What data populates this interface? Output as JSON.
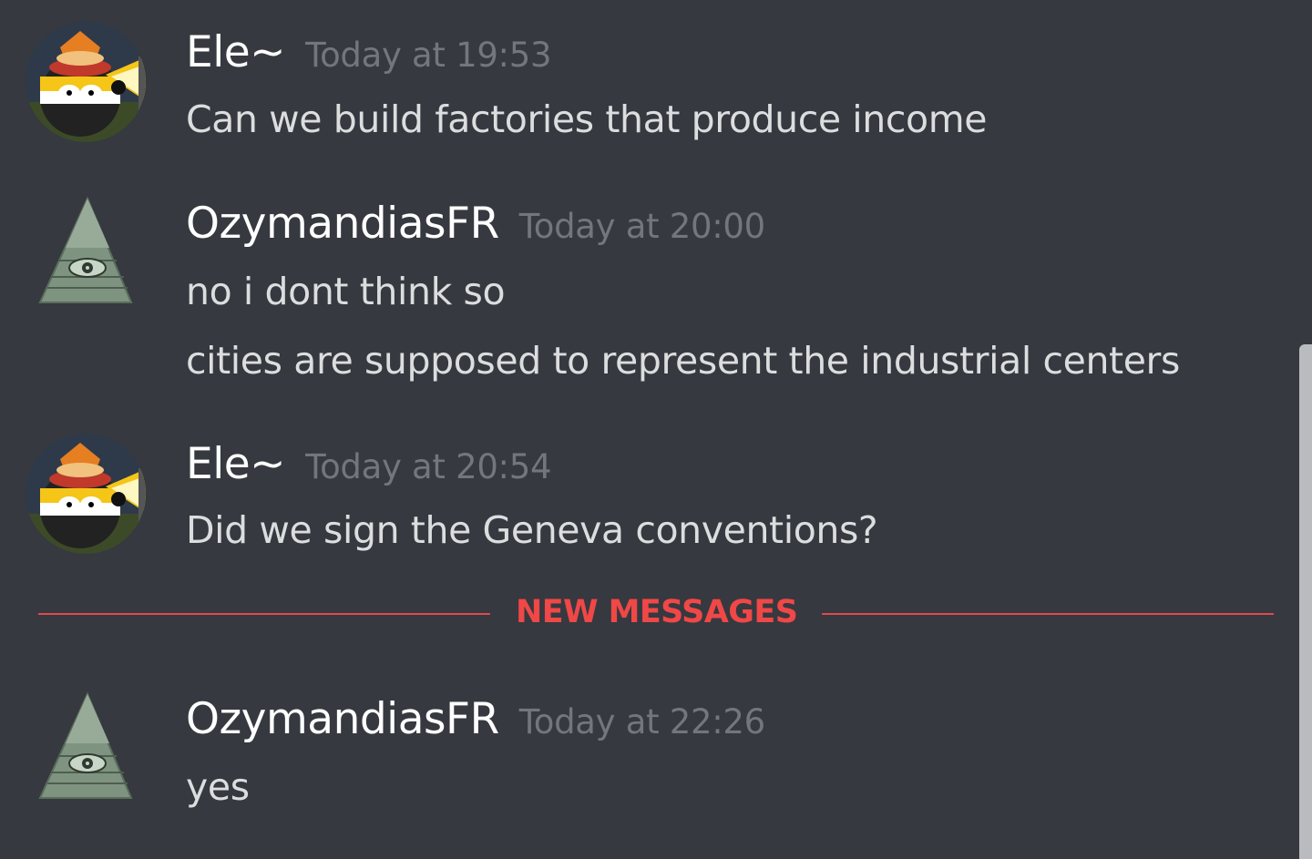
{
  "messages": [
    {
      "author": "Ele~",
      "avatar_icon": "countryball-avatar-icon",
      "timestamp": "Today at 19:53",
      "lines": [
        "Can we build factories that produce income"
      ]
    },
    {
      "author": "OzymandiasFR",
      "avatar_icon": "illuminati-pyramid-avatar-icon",
      "timestamp": "Today at 20:00",
      "lines": [
        "no i dont think so",
        "cities are supposed to represent the industrial centers"
      ]
    },
    {
      "author": "Ele~",
      "avatar_icon": "countryball-avatar-icon",
      "timestamp": "Today at 20:54",
      "lines": [
        "Did we sign the Geneva conventions?"
      ]
    },
    {
      "author": "OzymandiasFR",
      "avatar_icon": "illuminati-pyramid-avatar-icon",
      "timestamp": "Today at 22:26",
      "lines": [
        "yes"
      ]
    }
  ],
  "divider": {
    "label": "NEW MESSAGES",
    "color": "#f04747"
  },
  "colors": {
    "background": "#36393f",
    "username": "#ffffff",
    "timestamp": "#72767d",
    "message_text": "#dcddde"
  }
}
